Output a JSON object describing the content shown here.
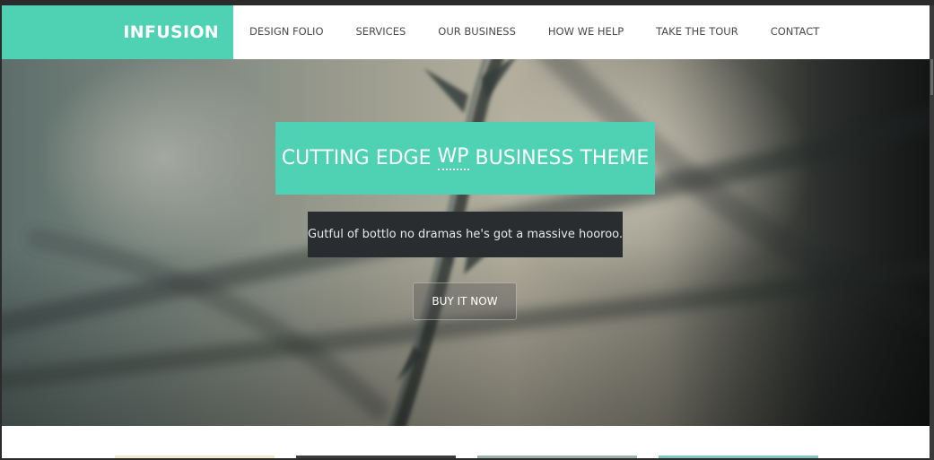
{
  "brand": {
    "logo": "INFUSION",
    "accent_color": "#4fd1b3"
  },
  "nav": {
    "items": [
      {
        "label": "DESIGN FOLIO"
      },
      {
        "label": "SERVICES"
      },
      {
        "label": "OUR BUSINESS"
      },
      {
        "label": "HOW WE HELP"
      },
      {
        "label": "TAKE THE TOUR"
      },
      {
        "label": "CONTACT"
      }
    ]
  },
  "hero": {
    "title_before": "CUTTING EDGE ",
    "title_abbr": "WP",
    "title_after": " BUSINESS THEME",
    "subtitle": "Gutful of bottlo no dramas he's got a massive hooroo.",
    "cta_label": "BUY IT NOW"
  }
}
